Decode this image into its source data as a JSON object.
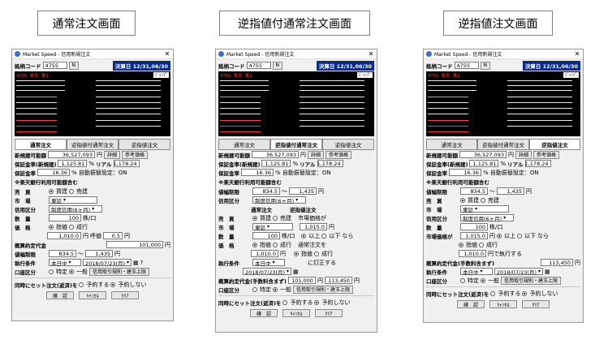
{
  "captions": [
    "通常注文画面",
    "逆指値付通常注文画面",
    "逆指値注文画面"
  ],
  "window": {
    "title": "Market Speed - 信用新規注文",
    "code_label": "銘柄コード",
    "code_value": "4755",
    "code_button": "N",
    "kessan": "決算日 12/31,06/30",
    "quote_header": "4755  楽天  東1",
    "quote_tag": "ｼﾞｬﾝﾌﾟ",
    "tabs": [
      "通常注文",
      "逆指値付通常注文",
      "逆指値注文"
    ],
    "buying_power_label": "新規建可能額",
    "buying_power_value": "36,527,093",
    "buying_power_unit": "円",
    "detail_button": "詳細",
    "ref_button": "参考価格",
    "margin_label": "保証金率(新規建)",
    "margin_value": "1,125.81",
    "margin_unit": "%",
    "real_label": "リアル",
    "real_value": "1,178.24",
    "margin_rate_label": "保証金率",
    "margin_rate_value": "16.36",
    "auto_deposit": "% 自動振替設定：ON",
    "note": "※楽天銀行利用可能額含む",
    "price_limit_label": "値幅制限",
    "price_limit_low": "834.5",
    "price_limit_high": "1,435",
    "price_limit_unit": "円",
    "side_label": "売　買",
    "side_buy": "買建",
    "side_sell": "売建",
    "market_label": "市　場",
    "market_value": "東証",
    "credit_label": "信用区分",
    "credit_value": "制度信用(6ヶ月)",
    "qty_label": "数　量",
    "qty_value": "100",
    "qty_unit": "株/口",
    "price_label": "価　格",
    "price_limit_opt": "指値",
    "price_market_opt": "成行",
    "price_value": "1,010.0",
    "tick_label": "呼値",
    "tick_value": "0.5",
    "tick_unit": "円",
    "trigger_label": "市場価格が",
    "trigger_value": "1,015.0",
    "above": "以上",
    "below": "以下",
    "then_label": "なら",
    "then_text": "円で執行する",
    "then_text2": "に訂正する",
    "normal_order": "逆指値注文",
    "normal_order2": "通常注文を",
    "est_label": "概算約定代金",
    "est_label2": "概算約定代金(手数料含まず)",
    "est_value_1": "101,000",
    "est_value_2": "113,450",
    "exec_label": "執行条件",
    "exec_value": "本日中",
    "date_value": "2018/07/23(月)",
    "account_label": "口座区分",
    "account_specific": "特定",
    "account_general": "一般",
    "credit_rule_button": "信用取引規則・建玉上限",
    "set_label": "同時にセット注文(返済)を",
    "set_yes": "予約する",
    "set_no": "予約しない",
    "confirm": "確　認",
    "cancel": "ｷｬﾝｾﾙ",
    "clear": "ｸﾘｱ"
  },
  "colors": {
    "quote_bg": "#000000",
    "kessan_bg": "#0a2a8a",
    "quote_header": "#ff3b3b",
    "app_icon": "#3a6fc4"
  }
}
